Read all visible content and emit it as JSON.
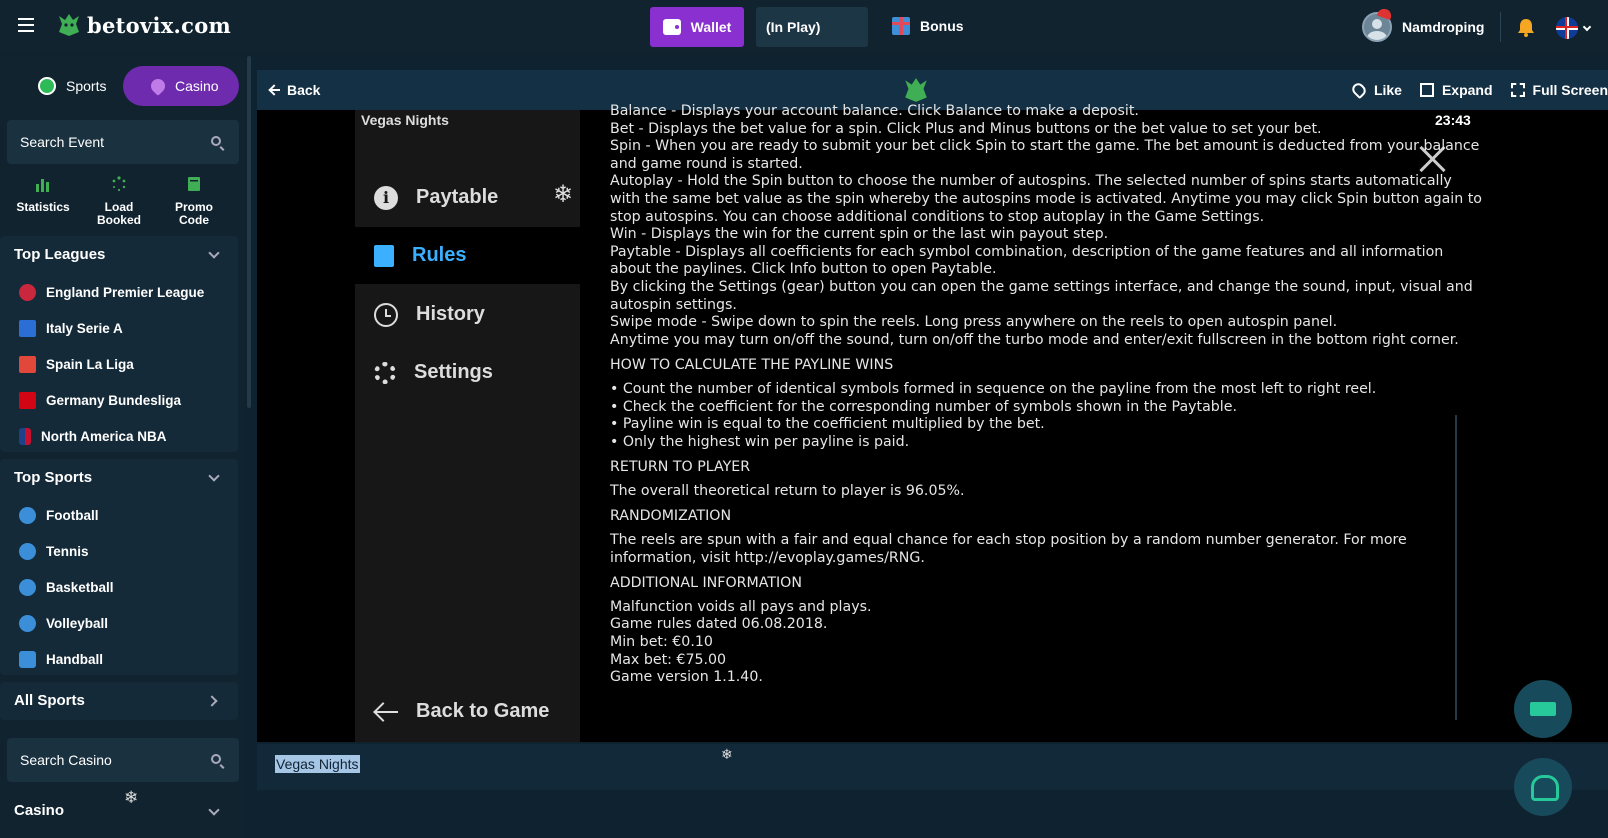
{
  "header": {
    "brand": "betovix.com",
    "wallet_label": "Wallet",
    "wallet_value": "(In Play)",
    "bonus_label": "Bonus",
    "username": "Namdroping"
  },
  "sidebar": {
    "tab_sports": "Sports",
    "tab_casino": "Casino",
    "search_event": "Search Event",
    "quick": [
      "Statistics",
      "Load Booked",
      "Promo Code"
    ],
    "top_leagues_title": "Top Leagues",
    "leagues": [
      "England Premier League",
      "Italy Serie A",
      "Spain La Liga",
      "Germany Bundesliga",
      "North America NBA"
    ],
    "top_sports_title": "Top Sports",
    "sports": [
      "Football",
      "Tennis",
      "Basketball",
      "Volleyball",
      "Handball"
    ],
    "all_sports": "All Sports",
    "search_casino": "Search Casino",
    "casino_section": "Casino"
  },
  "game_header": {
    "back": "Back",
    "like": "Like",
    "expand": "Expand",
    "fullscreen": "Full Screen"
  },
  "game": {
    "title": "Vegas Nights",
    "time": "23:43",
    "menu": [
      "Paytable",
      "Rules",
      "History",
      "Settings"
    ],
    "back_to_game": "Back to Game",
    "rules_lines": [
      "Balance - Displays your account balance. Click Balance to make a deposit.",
      "Bet - Displays the bet value for a spin. Click Plus and Minus buttons or the bet value to set your bet.",
      "Spin - When you are ready to submit your bet click Spin to start the game. The bet amount is deducted from your balance",
      "and game round is started.",
      "Autoplay - Hold the Spin button to choose the number of autospins. The selected number of spins starts automatically",
      "with the same bet value as the spin whereby the autospins mode is activated. Anytime you may click Spin button again to",
      "stop autospins. You can choose additional conditions to stop autoplay in the Game Settings.",
      "Win - Displays the win for the current spin or the last win payout step.",
      "Paytable - Displays all coefficients for each symbol combination, description of the game features and all information",
      "about the paylines. Click Info button to open Paytable.",
      "By clicking the Settings (gear) button you can open the game settings interface, and change the sound, input, visual and",
      "autospin settings.",
      "Swipe mode - Swipe down to spin the reels. Long press anywhere on the reels to open autospin panel.",
      "Anytime you may turn on/off the sound, turn on/off the turbo mode and enter/exit fullscreen in the bottom right corner."
    ],
    "payline_title": "HOW TO CALCULATE THE PAYLINE WINS",
    "payline_lines": [
      "• Count the number of identical symbols formed in sequence on the payline from the most left to right reel.",
      "• Check the coefficient for the corresponding number of symbols shown in the Paytable.",
      "• Payline win is equal to the coefficient multiplied by the bet.",
      "• Only the highest win per payline is paid."
    ],
    "rtp_title": "RETURN TO PLAYER",
    "rtp_text": "The overall theoretical return to player is 96.05%.",
    "random_title": "RANDOMIZATION",
    "random_lines": [
      "The reels are spun with a fair and equal chance for each stop position by a random number generator. For more",
      "information, visit http://evoplay.games/RNG."
    ],
    "additional_title": "ADDITIONAL INFORMATION",
    "additional_lines": [
      "Malfunction voids all pays and plays.",
      "Game rules dated 06.08.2018.",
      "Min bet: €0.10",
      "Max bet: €75.00",
      "Game version 1.1.40."
    ]
  },
  "bottom_bar": {
    "title": "Vegas Nights"
  }
}
